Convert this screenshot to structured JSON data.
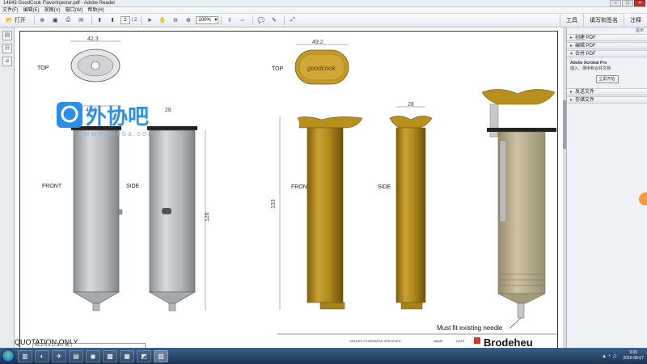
{
  "window": {
    "title": "14643 GoodCook FlavorInjector.pdf - Adobe Reader"
  },
  "menu": [
    "文件(F)",
    "编辑(E)",
    "视图(V)",
    "窗口(W)",
    "帮助(H)"
  ],
  "toolbar": {
    "open_label": "打开",
    "page_current": "2",
    "page_total": "/ 2",
    "zoom": "100%",
    "right_tabs": [
      "工具",
      "填写和签名",
      "注释"
    ]
  },
  "right_panel": {
    "top_link": "显示",
    "sections": [
      "创建 PDF",
      "编辑 PDF",
      "合并 PDF",
      "发送文件",
      "存储文件"
    ],
    "merge_body_title": "Adobe Acrobat Pro",
    "merge_body_text": "插入、排序和合并文档",
    "merge_button": "立即开始"
  },
  "drawing": {
    "labels": {
      "top": "TOP",
      "front_left": "FRONT",
      "side_left": "SIDE",
      "front_right": "FRONT",
      "side_right": "SIDE",
      "note": "Must fit existing needle",
      "quotation": "QUOTATION ONLY",
      "coords": "43.275 x 27.897 英寸",
      "unless": "UNLESS OTHERWISE SPECIFIED:",
      "name": "NAME",
      "date": "DATE",
      "brand": "Brodeheu",
      "cap_brand": "goodcook",
      "watermark_cn": "外协吧",
      "watermark_url": "www.xieba.com"
    },
    "dimensions": {
      "d_top_width": "42.3",
      "d_cap_width": "49.2",
      "d_left_width": "42.3",
      "d_side_small": "28",
      "d_right_side_width": "28",
      "d_left_height": "126",
      "d_right_height": "133"
    }
  },
  "taskbar": {
    "time": "9:05",
    "date": "2016-08-07"
  },
  "colors": {
    "gold": "#b8901e",
    "gold_dark": "#7d5e0c",
    "gray_body": "#b9bbbe",
    "watermark": "#2b8fe8"
  }
}
